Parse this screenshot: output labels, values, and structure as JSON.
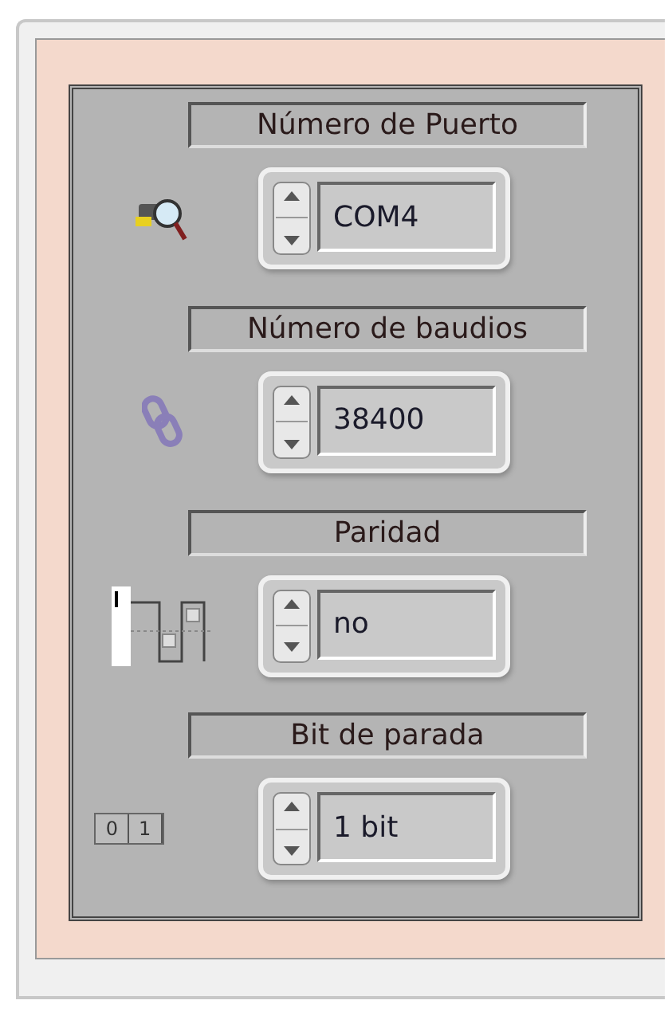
{
  "settings": [
    {
      "kind": "port",
      "label": "Número de Puerto",
      "value": "COM4"
    },
    {
      "kind": "baud",
      "label": "Número de baudios",
      "value": "38400"
    },
    {
      "kind": "parity",
      "label": "Paridad",
      "value": "no"
    },
    {
      "kind": "stopbits",
      "label": "Bit de parada",
      "value": "1 bit",
      "icon_texts": [
        "0",
        "1"
      ]
    }
  ]
}
